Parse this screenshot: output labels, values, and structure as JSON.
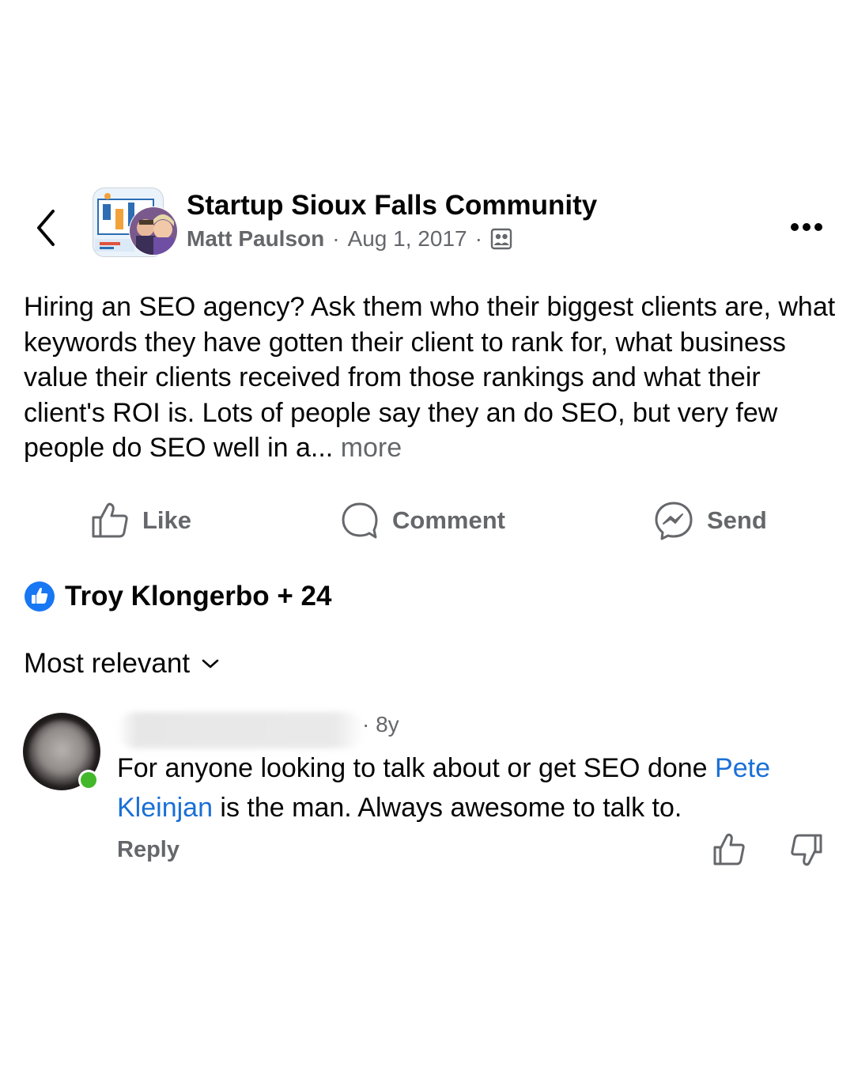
{
  "header": {
    "back_icon": "chevron-left-icon",
    "group_name": "Startup Sioux Falls Community",
    "author": "Matt Paulson",
    "separator": "·",
    "date": "Aug 1, 2017",
    "audience_icon": "group-members-icon",
    "more_icon": "more-options-icon"
  },
  "post": {
    "text": "Hiring an SEO agency? Ask them who their biggest clients are, what keywords they have gotten their client to rank for, what business value their clients received from those rankings and what their client's ROI is. Lots of people say they an do SEO, but very few people do SEO well in a...",
    "more_label": "more"
  },
  "actions": {
    "like_label": "Like",
    "comment_label": "Comment",
    "send_label": "Send"
  },
  "reactions": {
    "icon": "like-reaction-icon",
    "summary": "Troy Klongerbo + 24"
  },
  "sort": {
    "label": "Most relevant",
    "icon": "chevron-down-icon"
  },
  "comment": {
    "time": "· 8y",
    "text_before": "For anyone looking to talk about or get SEO done ",
    "mention": "Pete Kleinjan",
    "text_after": " is the man. Always awesome to talk to.",
    "reply_label": "Reply",
    "online_color": "#42b72a"
  },
  "colors": {
    "text_primary": "#050505",
    "text_secondary": "#65676b",
    "link": "#1a6fd6",
    "reaction_blue": "#1877f2"
  }
}
